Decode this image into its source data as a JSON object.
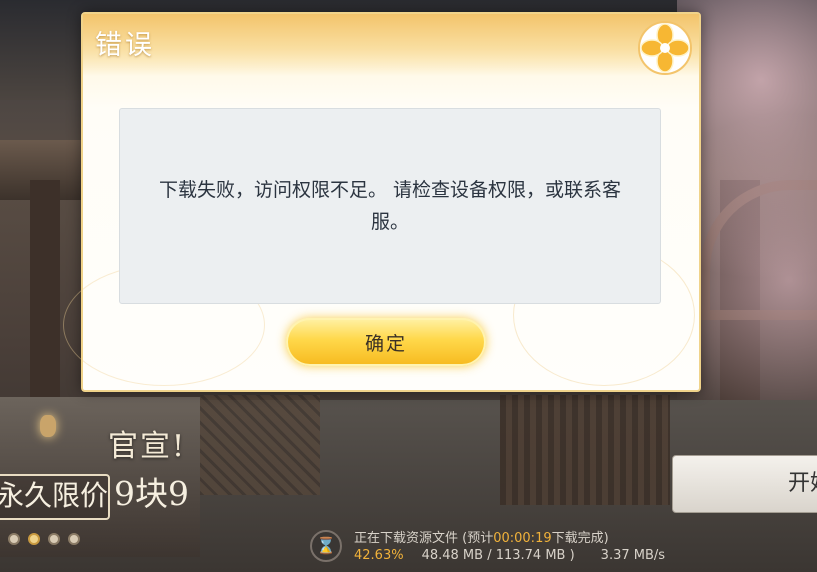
{
  "dialog": {
    "title": "错误",
    "message": "下载失败，访问权限不足。 请检查设备权限，或联系客服。",
    "confirm_label": "确定",
    "close_icon": "close-flower-icon"
  },
  "ad": {
    "title": "官宣!",
    "price_box": "永久限价",
    "price": "9块9",
    "slides": 4,
    "active_slide": 2
  },
  "start_button": {
    "label": "开始"
  },
  "download": {
    "status_prefix": "正在下载资源文件 (预计",
    "eta": "00:00:19",
    "status_suffix": "下载完成)",
    "percent": "42.63%",
    "sizes": "48.48 MB / 113.74 MB )",
    "speed": "3.37 MB/s",
    "icon": "hourglass-icon"
  },
  "colors": {
    "accent_gold": "#f3c46b",
    "progress_orange": "#f1b23a"
  }
}
